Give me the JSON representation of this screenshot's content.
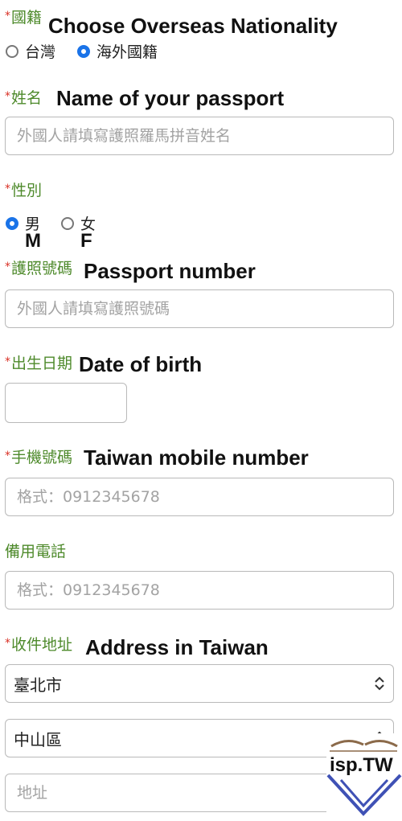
{
  "nationality": {
    "label": "國籍",
    "label_en": "Choose Overseas Nationality",
    "options": [
      {
        "label": "台灣",
        "selected": false
      },
      {
        "label": "海外國籍",
        "selected": true
      }
    ]
  },
  "name": {
    "label": "姓名",
    "label_en": "Name of your passport",
    "placeholder": "外國人請填寫護照羅馬拼音姓名"
  },
  "gender": {
    "label": "性別",
    "options": [
      {
        "label": "男",
        "en": "M",
        "selected": true
      },
      {
        "label": "女",
        "en": "F",
        "selected": false
      }
    ]
  },
  "passport": {
    "label": "護照號碼",
    "label_en": "Passport number",
    "placeholder": "外國人請填寫護照號碼"
  },
  "birth": {
    "label": "出生日期",
    "label_en": "Date of birth"
  },
  "mobile": {
    "label": "手機號碼",
    "label_en": "Taiwan mobile number",
    "placeholder": "格式：0912345678"
  },
  "backup_phone": {
    "label": "備用電話",
    "placeholder": "格式：0912345678"
  },
  "address": {
    "label": "收件地址",
    "label_en": "Address in Taiwan",
    "city": "臺北市",
    "district": "中山區",
    "placeholder": "地址"
  },
  "required_mark": "*",
  "logo": {
    "text": "isp.TW"
  },
  "colors": {
    "label_green": "#4e8a2b",
    "required_red": "#d93025",
    "radio_blue": "#1a73e8",
    "logo_blue": "#3f51b5"
  }
}
